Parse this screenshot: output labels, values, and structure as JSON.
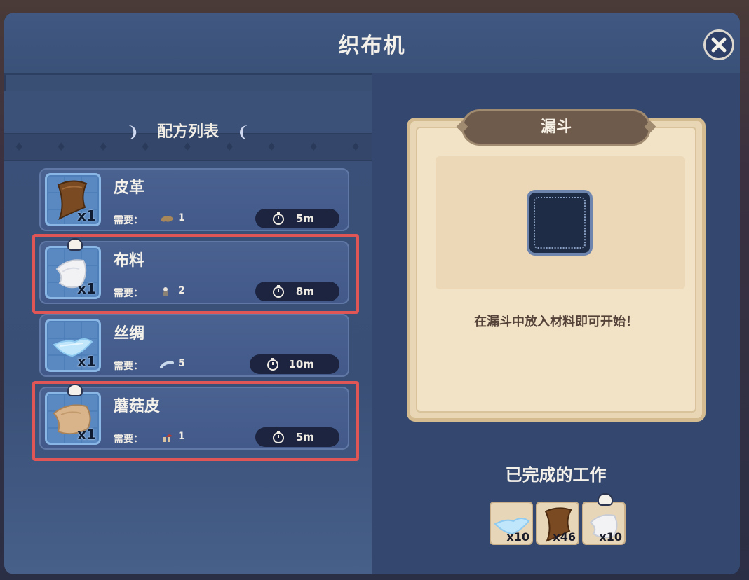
{
  "window": {
    "title": "织布机",
    "close_icon": "close-icon"
  },
  "recipe_list": {
    "header": "配方列表",
    "need_label": "需要：",
    "items": [
      {
        "name": "皮革",
        "output_qty": "x1",
        "need_count": "1",
        "time": "5m",
        "icon": "leather-icon",
        "need_icon": "hide-icon",
        "chef_badge": false,
        "highlighted": false
      },
      {
        "name": "布料",
        "output_qty": "x1",
        "need_count": "2",
        "time": "8m",
        "icon": "cloth-icon",
        "need_icon": "wool-icon",
        "chef_badge": true,
        "highlighted": true
      },
      {
        "name": "丝绸",
        "output_qty": "x1",
        "need_count": "5",
        "time": "10m",
        "icon": "silk-icon",
        "need_icon": "silk-thread-icon",
        "chef_badge": false,
        "highlighted": false
      },
      {
        "name": "蘑菇皮",
        "output_qty": "x1",
        "need_count": "1",
        "time": "5m",
        "icon": "mushroom-leather-icon",
        "need_icon": "mushroom-icon",
        "chef_badge": true,
        "highlighted": true
      }
    ]
  },
  "hopper": {
    "tab_title": "漏斗",
    "hint": "在漏斗中放入材料即可开始！"
  },
  "completed": {
    "title": "已完成的工作",
    "items": [
      {
        "count": "x10",
        "icon": "silk-icon"
      },
      {
        "count": "x46",
        "icon": "leather-icon"
      },
      {
        "count": "x10",
        "icon": "cloth-icon",
        "chef_badge": true
      }
    ]
  },
  "colors": {
    "highlight": "#e05555",
    "panel_bg": "#3a4f74",
    "parchment": "#f2e3c6"
  }
}
